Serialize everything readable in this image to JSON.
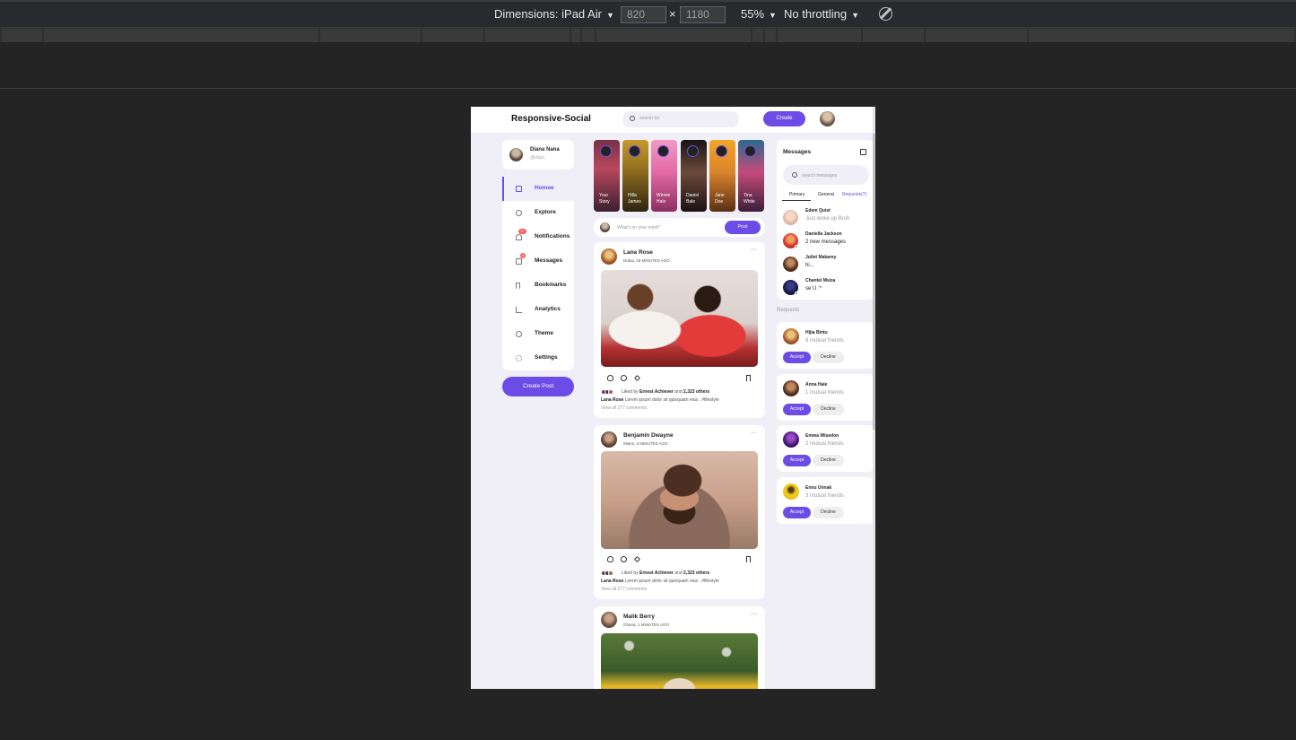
{
  "devtools": {
    "dimensions_label": "Dimensions: iPad Air",
    "width_value": "820",
    "height_value": "1180",
    "times": "×",
    "zoom": "55%",
    "throttling": "No throttling",
    "icons": [
      "caret-down-icon",
      "rotate-icon"
    ]
  },
  "app": {
    "logo": "Responsive-Social",
    "search_placeholder": "search for",
    "create_label": "Create",
    "accent": "#6b4ce6"
  },
  "profile": {
    "name": "Diana Nana",
    "handle": "@dayi"
  },
  "sidebar": {
    "items": [
      {
        "label": "Homee",
        "icon": "home-icon"
      },
      {
        "label": "Explore",
        "icon": "compass-icon"
      },
      {
        "label": "Notifications",
        "icon": "bell-icon",
        "badge": "9+"
      },
      {
        "label": "Messages",
        "icon": "envelope-icon",
        "badge": "6"
      },
      {
        "label": "Bookmarks",
        "icon": "bookmark-icon"
      },
      {
        "label": "Analytics",
        "icon": "chart-icon"
      },
      {
        "label": "Theme",
        "icon": "palette-icon"
      },
      {
        "label": "Settings",
        "icon": "gear-icon"
      }
    ],
    "create_post_label": "Create Post"
  },
  "stories": [
    {
      "line1": "Your",
      "line2": "Story"
    },
    {
      "line1": "Hilla",
      "line2": "James"
    },
    {
      "line1": "Winnie",
      "line2": "Hale"
    },
    {
      "line1": "Daniel",
      "line2": "Bale"
    },
    {
      "line1": "Jane",
      "line2": "Doe"
    },
    {
      "line1": "Tina",
      "line2": "White"
    }
  ],
  "composer": {
    "placeholder": "What's on your mind?",
    "post_label": "Post"
  },
  "feed": [
    {
      "author": "Lana Rose",
      "meta": "Dubai, 15 MINUTES AGO",
      "more": "···",
      "liked_by_prefix": "Liked by",
      "liked_by_name": "Ernest Achiever",
      "liked_and": "and",
      "liked_others": "2,323 others",
      "caption_author": "Lana Rose",
      "caption_text": "Lorem ipsum dolor sit quisquam eius . #lifestyle",
      "view_comments": "View all 277 comments"
    },
    {
      "author": "Benjamin Dwayne",
      "meta": "Miami, 2 MINUTES AGO",
      "more": "···",
      "liked_by_prefix": "Liked by",
      "liked_by_name": "Ernest Achiever",
      "liked_and": "and",
      "liked_others": "2,323 others",
      "caption_author": "Lana Rose",
      "caption_text": "Lorem ipsum dolor sit quisquam eius . #lifestyle",
      "view_comments": "View all 277 comments"
    },
    {
      "author": "Malik Berry",
      "meta": "Ghana, 1 MINUTES AGO",
      "more": "···"
    }
  ],
  "messages": {
    "title": "Messages",
    "search_placeholder": "search messages",
    "tabs": [
      "Primary",
      "General",
      "Requests(7)"
    ],
    "items": [
      {
        "name": "Edem Quist",
        "preview": "Just woke up Bruh",
        "online": false,
        "unread": false
      },
      {
        "name": "Daniella Jackson",
        "preview": "2 new messages",
        "online": true,
        "unread": true
      },
      {
        "name": "Juliet Makarey",
        "preview": "hi...",
        "online": false,
        "unread": true
      },
      {
        "name": "Chantel Msiza",
        "preview": "se U :*",
        "online": true,
        "unread": true
      }
    ]
  },
  "requests": {
    "heading": "Requests",
    "accept_label": "Accept",
    "decline_label": "Decline",
    "items": [
      {
        "name": "Hijia Bintu",
        "mutual": "8 mutual friends"
      },
      {
        "name": "Anna Hale",
        "mutual": "1 mutual friends"
      },
      {
        "name": "Emma Wisedon",
        "mutual": "2 mutual friends"
      },
      {
        "name": "Ennu Unnak",
        "mutual": "3 mutual friends"
      }
    ]
  }
}
